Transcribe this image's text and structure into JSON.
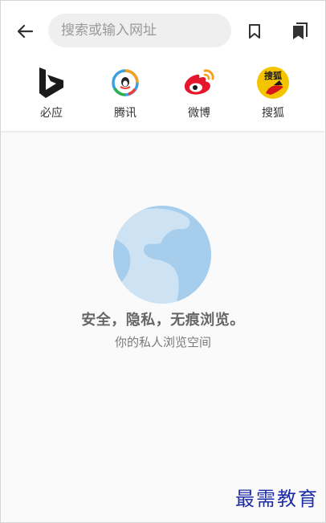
{
  "toolbar": {
    "search_placeholder": "搜索或输入网址",
    "back_icon": "arrow-left-icon",
    "bookmark_icon": "bookmark-icon",
    "bookmarks_icon": "bookmarks-icon"
  },
  "shortcuts": [
    {
      "label": "必应",
      "icon": "bing-icon"
    },
    {
      "label": "腾讯",
      "icon": "tencent-icon"
    },
    {
      "label": "微博",
      "icon": "weibo-icon"
    },
    {
      "label": "搜狐",
      "icon": "sohu-icon",
      "icon_text": "搜狐"
    }
  ],
  "incognito": {
    "title": "安全，隐私，无痕浏览。",
    "subtitle": "你的私人浏览空间",
    "icon": "globe-icon"
  },
  "watermark": "最需教育",
  "colors": {
    "globe_light": "#cde3f3",
    "globe_dark": "#9dc7e8",
    "watermark": "#1e2ea8"
  }
}
